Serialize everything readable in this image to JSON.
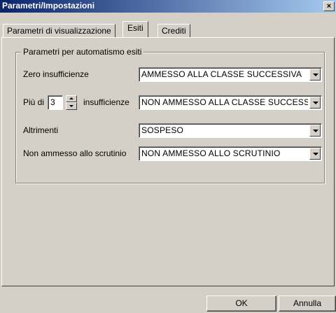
{
  "window": {
    "title": "Parametri/Impostazioni",
    "close_glyph": "×"
  },
  "tabs": [
    {
      "label": "Parametri di visualizzazione",
      "active": false
    },
    {
      "label": "Esiti",
      "active": true
    },
    {
      "label": "Crediti",
      "active": false
    }
  ],
  "group": {
    "legend": "Parametri per automatismo esiti"
  },
  "rows": {
    "zero_label": "Zero insufficienze",
    "zero_value": "AMMESSO ALLA CLASSE SUCCESSIVA",
    "piu_di_label": "Più di",
    "piu_di_count": "3",
    "insufficienze_label": "insufficienze",
    "piu_di_value": "NON AMMESSO ALLA CLASSE SUCCESSIVA",
    "altrimenti_label": "Altrimenti",
    "altrimenti_value": "SOSPESO",
    "non_ammesso_label": "Non ammesso allo scrutinio",
    "non_ammesso_value": "NON AMMESSO ALLO SCRUTINIO"
  },
  "buttons": {
    "ok": "OK",
    "cancel": "Annulla"
  },
  "icons": {
    "close": "close-icon",
    "dropdown": "chevron-down-icon",
    "spin_up": "spin-up-icon",
    "spin_down": "spin-down-icon"
  },
  "colors": {
    "face": "#d4d0c8",
    "title_start": "#0a246a",
    "title_end": "#a6caf0"
  }
}
